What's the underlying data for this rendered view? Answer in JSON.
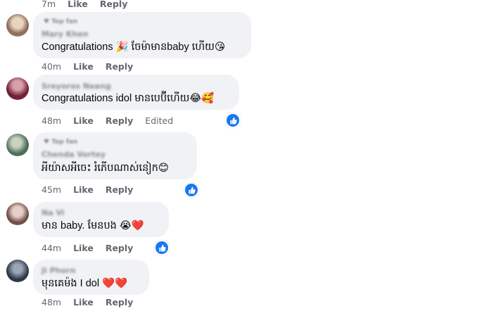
{
  "comments": [
    {
      "badge": "Top fan",
      "author": "Mary Khen",
      "text": "Congratulations 🎉 ចែម៉ាមានbaby ហើយ😘",
      "time": "40m",
      "like": "Like",
      "reply": "Reply",
      "avatar_color": "#b89a86"
    },
    {
      "author": "Sreyoros Neang",
      "text": "Congratulations idol មានបេប៊ីហើយ😂🥰",
      "time": "48m",
      "like": "Like",
      "reply": "Reply",
      "edited": "Edited",
      "avatar_color": "#8b2d4a",
      "reaction": "like"
    },
    {
      "badge": "Top fan",
      "author": "Chenda Vortey",
      "text": "អីយ៉ាសអីចេះ រំភើបណាស់នៀក😊",
      "time": "45m",
      "like": "Like",
      "reply": "Reply",
      "avatar_color": "#5f7a6a",
      "reaction": "like"
    },
    {
      "author": "Na Vi",
      "text": "មាន baby. មែនបង 😭❤️",
      "time": "44m",
      "like": "Like",
      "reply": "Reply",
      "avatar_color": "#8a6a66",
      "reaction": "like"
    },
    {
      "author": "Ji Phorn",
      "text": "មុនគេម៉ង I dol ❤️❤️",
      "time": "48m",
      "like": "Like",
      "reply": "Reply",
      "avatar_color": "#3c4a5c"
    }
  ],
  "top_partial": {
    "time": "7m",
    "like": "Like",
    "reply": "Reply"
  }
}
